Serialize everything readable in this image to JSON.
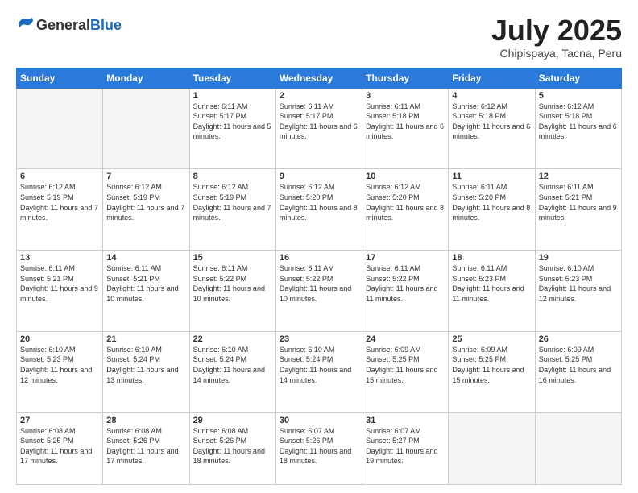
{
  "header": {
    "logo_general": "General",
    "logo_blue": "Blue",
    "month_title": "July 2025",
    "subtitle": "Chipispaya, Tacna, Peru"
  },
  "weekdays": [
    "Sunday",
    "Monday",
    "Tuesday",
    "Wednesday",
    "Thursday",
    "Friday",
    "Saturday"
  ],
  "weeks": [
    [
      {
        "day": "",
        "sunrise": "",
        "sunset": "",
        "daylight": "",
        "empty": true
      },
      {
        "day": "",
        "sunrise": "",
        "sunset": "",
        "daylight": "",
        "empty": true
      },
      {
        "day": "1",
        "sunrise": "Sunrise: 6:11 AM",
        "sunset": "Sunset: 5:17 PM",
        "daylight": "Daylight: 11 hours and 5 minutes."
      },
      {
        "day": "2",
        "sunrise": "Sunrise: 6:11 AM",
        "sunset": "Sunset: 5:17 PM",
        "daylight": "Daylight: 11 hours and 6 minutes."
      },
      {
        "day": "3",
        "sunrise": "Sunrise: 6:11 AM",
        "sunset": "Sunset: 5:18 PM",
        "daylight": "Daylight: 11 hours and 6 minutes."
      },
      {
        "day": "4",
        "sunrise": "Sunrise: 6:12 AM",
        "sunset": "Sunset: 5:18 PM",
        "daylight": "Daylight: 11 hours and 6 minutes."
      },
      {
        "day": "5",
        "sunrise": "Sunrise: 6:12 AM",
        "sunset": "Sunset: 5:18 PM",
        "daylight": "Daylight: 11 hours and 6 minutes."
      }
    ],
    [
      {
        "day": "6",
        "sunrise": "Sunrise: 6:12 AM",
        "sunset": "Sunset: 5:19 PM",
        "daylight": "Daylight: 11 hours and 7 minutes."
      },
      {
        "day": "7",
        "sunrise": "Sunrise: 6:12 AM",
        "sunset": "Sunset: 5:19 PM",
        "daylight": "Daylight: 11 hours and 7 minutes."
      },
      {
        "day": "8",
        "sunrise": "Sunrise: 6:12 AM",
        "sunset": "Sunset: 5:19 PM",
        "daylight": "Daylight: 11 hours and 7 minutes."
      },
      {
        "day": "9",
        "sunrise": "Sunrise: 6:12 AM",
        "sunset": "Sunset: 5:20 PM",
        "daylight": "Daylight: 11 hours and 8 minutes."
      },
      {
        "day": "10",
        "sunrise": "Sunrise: 6:12 AM",
        "sunset": "Sunset: 5:20 PM",
        "daylight": "Daylight: 11 hours and 8 minutes."
      },
      {
        "day": "11",
        "sunrise": "Sunrise: 6:11 AM",
        "sunset": "Sunset: 5:20 PM",
        "daylight": "Daylight: 11 hours and 8 minutes."
      },
      {
        "day": "12",
        "sunrise": "Sunrise: 6:11 AM",
        "sunset": "Sunset: 5:21 PM",
        "daylight": "Daylight: 11 hours and 9 minutes."
      }
    ],
    [
      {
        "day": "13",
        "sunrise": "Sunrise: 6:11 AM",
        "sunset": "Sunset: 5:21 PM",
        "daylight": "Daylight: 11 hours and 9 minutes."
      },
      {
        "day": "14",
        "sunrise": "Sunrise: 6:11 AM",
        "sunset": "Sunset: 5:21 PM",
        "daylight": "Daylight: 11 hours and 10 minutes."
      },
      {
        "day": "15",
        "sunrise": "Sunrise: 6:11 AM",
        "sunset": "Sunset: 5:22 PM",
        "daylight": "Daylight: 11 hours and 10 minutes."
      },
      {
        "day": "16",
        "sunrise": "Sunrise: 6:11 AM",
        "sunset": "Sunset: 5:22 PM",
        "daylight": "Daylight: 11 hours and 10 minutes."
      },
      {
        "day": "17",
        "sunrise": "Sunrise: 6:11 AM",
        "sunset": "Sunset: 5:22 PM",
        "daylight": "Daylight: 11 hours and 11 minutes."
      },
      {
        "day": "18",
        "sunrise": "Sunrise: 6:11 AM",
        "sunset": "Sunset: 5:23 PM",
        "daylight": "Daylight: 11 hours and 11 minutes."
      },
      {
        "day": "19",
        "sunrise": "Sunrise: 6:10 AM",
        "sunset": "Sunset: 5:23 PM",
        "daylight": "Daylight: 11 hours and 12 minutes."
      }
    ],
    [
      {
        "day": "20",
        "sunrise": "Sunrise: 6:10 AM",
        "sunset": "Sunset: 5:23 PM",
        "daylight": "Daylight: 11 hours and 12 minutes."
      },
      {
        "day": "21",
        "sunrise": "Sunrise: 6:10 AM",
        "sunset": "Sunset: 5:24 PM",
        "daylight": "Daylight: 11 hours and 13 minutes."
      },
      {
        "day": "22",
        "sunrise": "Sunrise: 6:10 AM",
        "sunset": "Sunset: 5:24 PM",
        "daylight": "Daylight: 11 hours and 14 minutes."
      },
      {
        "day": "23",
        "sunrise": "Sunrise: 6:10 AM",
        "sunset": "Sunset: 5:24 PM",
        "daylight": "Daylight: 11 hours and 14 minutes."
      },
      {
        "day": "24",
        "sunrise": "Sunrise: 6:09 AM",
        "sunset": "Sunset: 5:25 PM",
        "daylight": "Daylight: 11 hours and 15 minutes."
      },
      {
        "day": "25",
        "sunrise": "Sunrise: 6:09 AM",
        "sunset": "Sunset: 5:25 PM",
        "daylight": "Daylight: 11 hours and 15 minutes."
      },
      {
        "day": "26",
        "sunrise": "Sunrise: 6:09 AM",
        "sunset": "Sunset: 5:25 PM",
        "daylight": "Daylight: 11 hours and 16 minutes."
      }
    ],
    [
      {
        "day": "27",
        "sunrise": "Sunrise: 6:08 AM",
        "sunset": "Sunset: 5:25 PM",
        "daylight": "Daylight: 11 hours and 17 minutes."
      },
      {
        "day": "28",
        "sunrise": "Sunrise: 6:08 AM",
        "sunset": "Sunset: 5:26 PM",
        "daylight": "Daylight: 11 hours and 17 minutes."
      },
      {
        "day": "29",
        "sunrise": "Sunrise: 6:08 AM",
        "sunset": "Sunset: 5:26 PM",
        "daylight": "Daylight: 11 hours and 18 minutes."
      },
      {
        "day": "30",
        "sunrise": "Sunrise: 6:07 AM",
        "sunset": "Sunset: 5:26 PM",
        "daylight": "Daylight: 11 hours and 18 minutes."
      },
      {
        "day": "31",
        "sunrise": "Sunrise: 6:07 AM",
        "sunset": "Sunset: 5:27 PM",
        "daylight": "Daylight: 11 hours and 19 minutes."
      },
      {
        "day": "",
        "sunrise": "",
        "sunset": "",
        "daylight": "",
        "empty": true
      },
      {
        "day": "",
        "sunrise": "",
        "sunset": "",
        "daylight": "",
        "empty": true
      }
    ]
  ]
}
